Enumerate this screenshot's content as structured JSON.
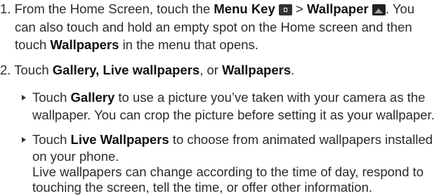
{
  "step1": {
    "number": "1.",
    "t1": "From the Home Screen, touch the",
    "menu_key": "Menu Key",
    "sep": ">",
    "wallpaper": "Wallpaper",
    "t2": ". You",
    "line2": "can also touch and hold an empty spot on the Home screen and then",
    "t3": "touch",
    "wallpapers": "Wallpapers",
    "t4": "in the menu that opens.",
    "icons": [
      "menu-key-icon",
      "wallpaper-icon"
    ]
  },
  "step2": {
    "number": "2.",
    "t1": "Touch",
    "gallery": "Gallery,",
    "live": "Live wallpapers",
    "comma": ", or",
    "wallpapers": "Wallpapers",
    "period": "."
  },
  "bullet1": {
    "t1": "Touch",
    "gallery": "Gallery",
    "t2": "to use a picture you’ve taken with your camera as the",
    "line2": "wallpaper. You can crop the picture before setting it as your wallpaper."
  },
  "bullet2": {
    "t1": "Touch",
    "live": "Live Wallpapers",
    "t2": "to choose from animated wallpapers installed",
    "line2": "on your phone.",
    "line3": "Live wallpapers can change according to the time of day, respond to",
    "line4": "touching the screen, tell the time, or offer other information."
  }
}
